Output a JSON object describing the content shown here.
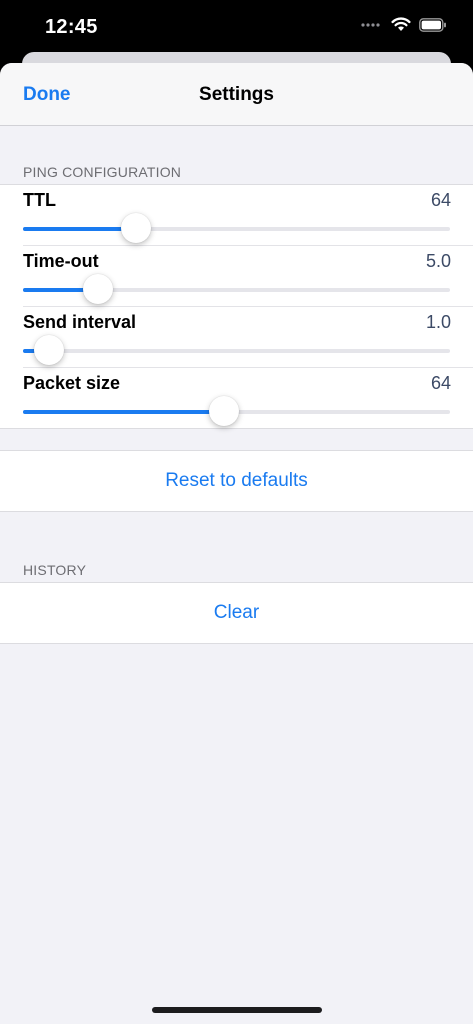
{
  "status_bar": {
    "time": "12:45"
  },
  "nav": {
    "done_label": "Done",
    "title": "Settings"
  },
  "ping_section": {
    "header": "PING CONFIGURATION",
    "sliders": [
      {
        "label": "TTL",
        "value": "64",
        "fraction": 0.265
      },
      {
        "label": "Time-out",
        "value": "5.0",
        "fraction": 0.175
      },
      {
        "label": "Send interval",
        "value": "1.0",
        "fraction": 0.06
      },
      {
        "label": "Packet size",
        "value": "64",
        "fraction": 0.47
      }
    ]
  },
  "reset_button": {
    "label": "Reset to defaults"
  },
  "history_section": {
    "header": "HISTORY",
    "clear_label": "Clear"
  },
  "colors": {
    "accent": "#1a7bf0",
    "track": "#e5e5ea",
    "background": "#f2f2f7"
  }
}
